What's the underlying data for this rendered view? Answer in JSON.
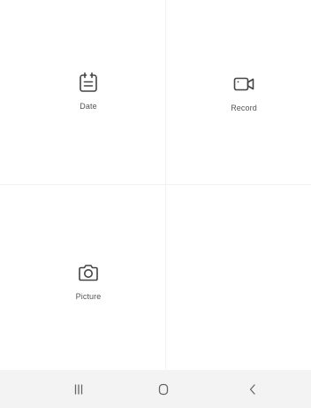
{
  "options": [
    {
      "label": "Date",
      "icon": "calendar-icon"
    },
    {
      "label": "Record",
      "icon": "video-camera-icon"
    },
    {
      "label": "Picture",
      "icon": "camera-icon"
    }
  ],
  "navbar": {
    "recents_icon": "recents-icon",
    "home_icon": "home-icon",
    "back_icon": "back-icon"
  },
  "colors": {
    "background": "#ffffff",
    "navbar": "#f3f3f3",
    "icon": "#444444",
    "label": "#555555"
  }
}
